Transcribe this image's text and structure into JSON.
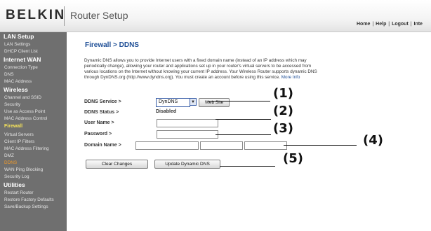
{
  "header": {
    "logo": "BELKIN",
    "title": "Router Setup",
    "links": [
      "Home",
      "Help",
      "Logout",
      "Inte"
    ]
  },
  "sidebar": {
    "sections": [
      {
        "heading": "LAN Setup",
        "items": [
          "LAN Settings",
          "DHCP Client List"
        ]
      },
      {
        "heading": "Internet WAN",
        "items": [
          "Connection Type",
          "DNS",
          "MAC Address"
        ]
      },
      {
        "heading": "Wireless",
        "items": [
          "Channel and SSID",
          "Security",
          "Use as Access Point",
          "MAC Address Control"
        ]
      },
      {
        "heading": "Firewall",
        "items": [
          "Virtual Servers",
          "Client IP Filters",
          "MAC Address Filtering",
          "DMZ",
          "DDNS",
          "WAN Ping Blocking",
          "Security Log"
        ]
      },
      {
        "heading": "Utilities",
        "items": [
          "Restart Router",
          "Restore Factory Defaults",
          "Save/Backup Settings"
        ]
      }
    ]
  },
  "main": {
    "title": "Firewall > DDNS",
    "description": "Dynamic DNS allows you to provide Internet users with a fixed domain name (instead of an IP address which may periodically change), allowing your router and applications set up in your router's virtual servers to be accessed from various locations on the Internet without knowing your current IP address. Your Wireless Router supports dynamic DNS through DynDNS.org (http://www.dyndns.org). You must create an account before using this service.",
    "more_info": "More Info",
    "ddns_service_label": "DDNS Service >",
    "ddns_service_value": "DynDNS",
    "website_button": "Web Site",
    "ddns_status_label": "DDNS Status >",
    "ddns_status_value": "Disabled",
    "username_label": "User Name >",
    "username_value": "",
    "password_label": "Password >",
    "password_value": "",
    "domain_label": "Domain Name >",
    "domain_values": [
      "",
      "",
      ""
    ],
    "clear_button": "Clear Changes",
    "update_button": "Update Dynamic DNS"
  },
  "annotations": [
    "(1)",
    "(2)",
    "(3)",
    "(4)",
    "(5)"
  ],
  "colors": {
    "sidebar_bg": "#6f6f6f",
    "title_blue": "#1f4f96",
    "active_yellow": "#f7e45a",
    "active_orange": "#f09a2a"
  }
}
